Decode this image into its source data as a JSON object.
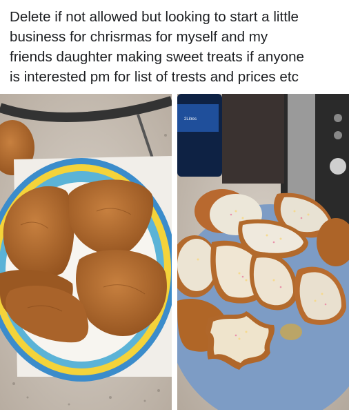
{
  "post": {
    "text": "Delete if not allowed but looking to start a little\nbusiness for chrisrmas for myself and my\nfriends daughter making sweet treats if anyone\nis interested pm for list of trests and prices etc"
  },
  "photos": [
    {
      "subject": "plain gingerbread cookies on a patterned plate"
    },
    {
      "subject": "iced gingerbread cookies with sprinkles on a blue plate"
    }
  ],
  "bottle_label": "2Litres"
}
